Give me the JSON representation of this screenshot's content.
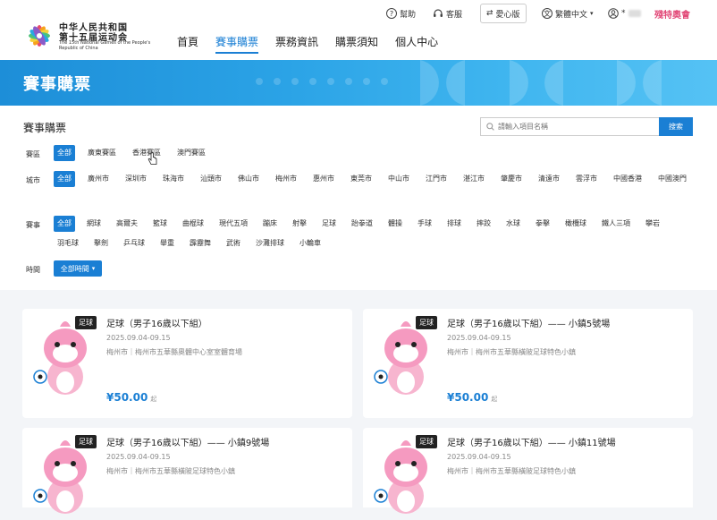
{
  "header": {
    "logo": {
      "line1": "中华人民共和国",
      "line2": "第十五届运动会",
      "en": "The 15th National Games of the People's Republic of China"
    },
    "topbar": {
      "help": "幫助",
      "service": "客服",
      "care": "愛心版",
      "language": "繁體中文",
      "user": "*",
      "brand": "殘特奧會"
    },
    "nav": [
      "首頁",
      "賽事購票",
      "票務資訊",
      "購票須知",
      "個人中心"
    ],
    "nav_active": "賽事購票"
  },
  "banner": {
    "title": "賽事購票"
  },
  "filter": {
    "title": "賽事購票",
    "search": {
      "placeholder": "請輸入項目名稱",
      "button": "搜索"
    },
    "region": {
      "label": "賽區",
      "options": [
        "全部",
        "廣東賽區",
        "香港賽區",
        "澳門賽區"
      ],
      "selected": "全部"
    },
    "city": {
      "label": "城市",
      "options": [
        "全部",
        "廣州市",
        "深圳市",
        "珠海市",
        "汕頭市",
        "佛山市",
        "梅州市",
        "惠州市",
        "東莞市",
        "中山市",
        "江門市",
        "湛江市",
        "肇慶市",
        "清遠市",
        "雲浮市",
        "中國香港",
        "中國澳門"
      ],
      "selected": "全部"
    },
    "event": {
      "label": "賽事",
      "options": [
        "全部",
        "網球",
        "高爾夫",
        "籃球",
        "曲棍球",
        "現代五項",
        "蹦床",
        "射擊",
        "足球",
        "跆拳道",
        "體操",
        "手球",
        "排球",
        "摔跤",
        "水球",
        "拳擊",
        "橄欖球",
        "鐵人三項",
        "攀岩",
        "羽毛球",
        "擊劍",
        "乒乓球",
        "舉重",
        "霹靂舞",
        "武術",
        "沙灘排球",
        "小輪車"
      ],
      "selected": "全部"
    },
    "time": {
      "label": "時間",
      "value": "全部時間"
    }
  },
  "cards": [
    {
      "tag": "足球",
      "title": "足球（男子16歲以下組）",
      "date": "2025.09.04-09.15",
      "venue": "梅州市｜梅州市五華縣奧體中心室室體育場",
      "price": "¥50.00",
      "unit": "起"
    },
    {
      "tag": "足球",
      "title": "足球（男子16歲以下組）—— 小鎮5號場",
      "date": "2025.09.04-09.15",
      "venue": "梅州市｜梅州市五華縣橫陂足球特色小鎮",
      "price": "¥50.00",
      "unit": "起"
    },
    {
      "tag": "足球",
      "title": "足球（男子16歲以下組）—— 小鎮9號場",
      "date": "2025.09.04-09.15",
      "venue": "梅州市｜梅州市五華縣橫陂足球特色小鎮",
      "price": "",
      "unit": ""
    },
    {
      "tag": "足球",
      "title": "足球（男子16歲以下組）—— 小鎮11號場",
      "date": "2025.09.04-09.15",
      "venue": "梅州市｜梅州市五華縣橫陂足球特色小鎮",
      "price": "",
      "unit": ""
    }
  ],
  "colors": {
    "accent": "#1a7fd4",
    "mascot": "#f59ac0",
    "brand": "#e24c7a"
  }
}
